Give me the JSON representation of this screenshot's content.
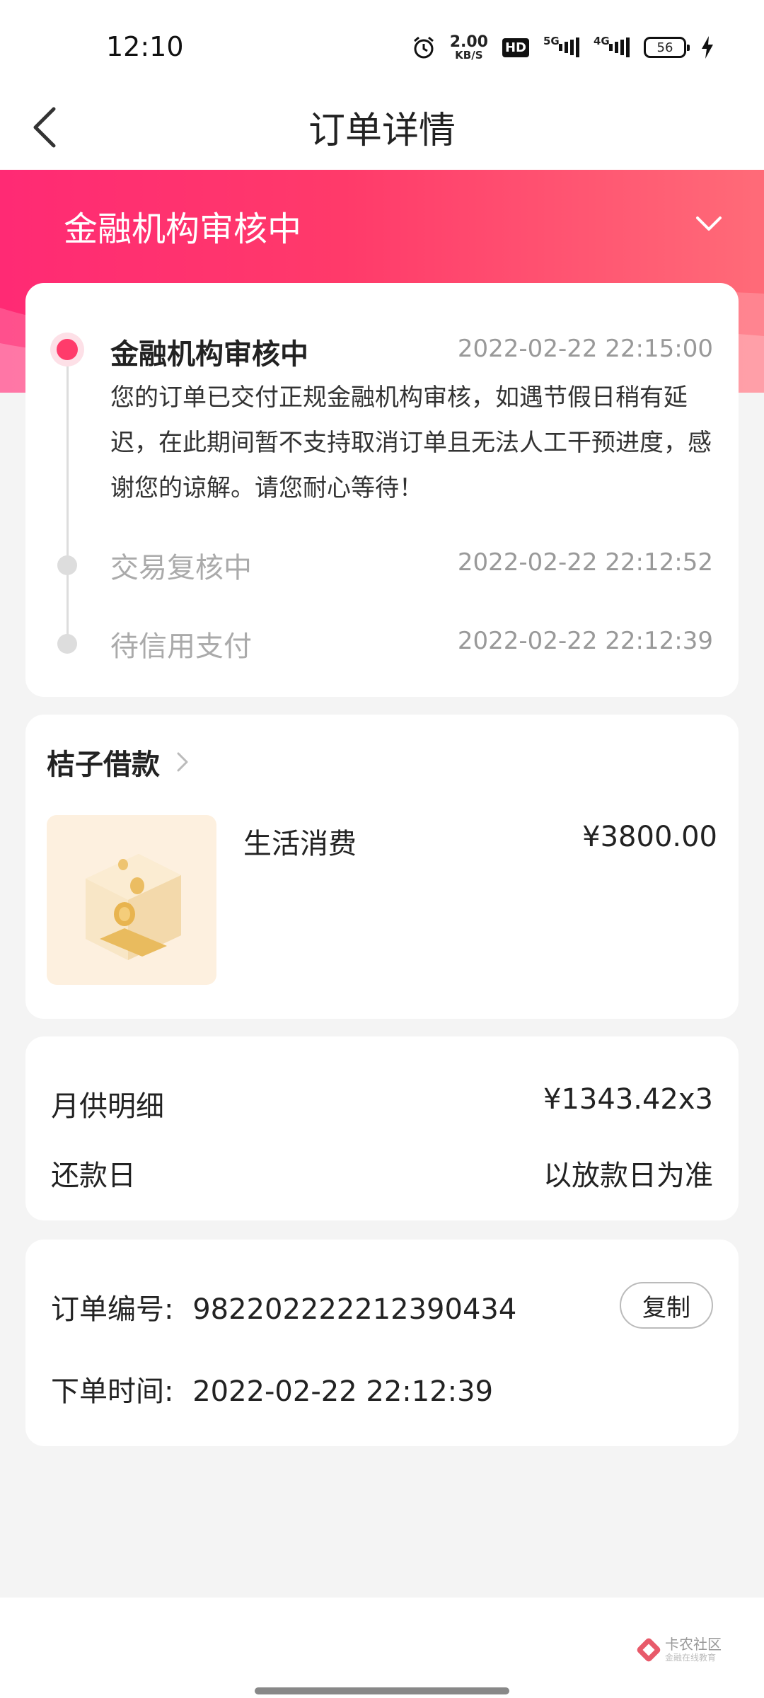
{
  "status_bar": {
    "time": "12:10",
    "net_speed_value": "2.00",
    "net_speed_unit": "KB/S",
    "hd_label": "HD",
    "sim1_label": "5G",
    "sim2_label": "4G",
    "battery": "56",
    "icons": [
      "alarm-icon",
      "hd-icon",
      "signal-icon",
      "battery-icon",
      "charging-icon"
    ]
  },
  "header": {
    "title": "订单详情",
    "back_icon": "chevron-left-icon"
  },
  "banner": {
    "status_title": "金融机构审核中",
    "toggle_icon": "chevron-down-icon",
    "accent_color": "#ff2a74"
  },
  "timeline": [
    {
      "title": "金融机构审核中",
      "time": "2022-02-22 22:15:00",
      "desc": "您的订单已交付正规金融机构审核，如遇节假日稍有延迟，在此期间暂不支持取消订单且无法人工干预进度，感谢您的谅解。请您耐心等待！",
      "active": true
    },
    {
      "title": "交易复核中",
      "time": "2022-02-22 22:12:52",
      "active": false
    },
    {
      "title": "待信用支付",
      "time": "2022-02-22 22:12:39",
      "active": false
    }
  ],
  "product": {
    "merchant": "桔子借款",
    "name": "生活消费",
    "price": "¥3800.00"
  },
  "repayment": {
    "monthly_label": "月供明细",
    "monthly_value": "¥1343.42x3",
    "due_label": "还款日",
    "due_value": "以放款日为准"
  },
  "order": {
    "number_label": "订单编号:",
    "number_value": "982202222212390434",
    "copy_label": "复制",
    "time_label": "下单时间:",
    "time_value": "2022-02-22 22:12:39"
  },
  "watermark": {
    "main": "卡农社区",
    "sub": "金融在线教育"
  }
}
